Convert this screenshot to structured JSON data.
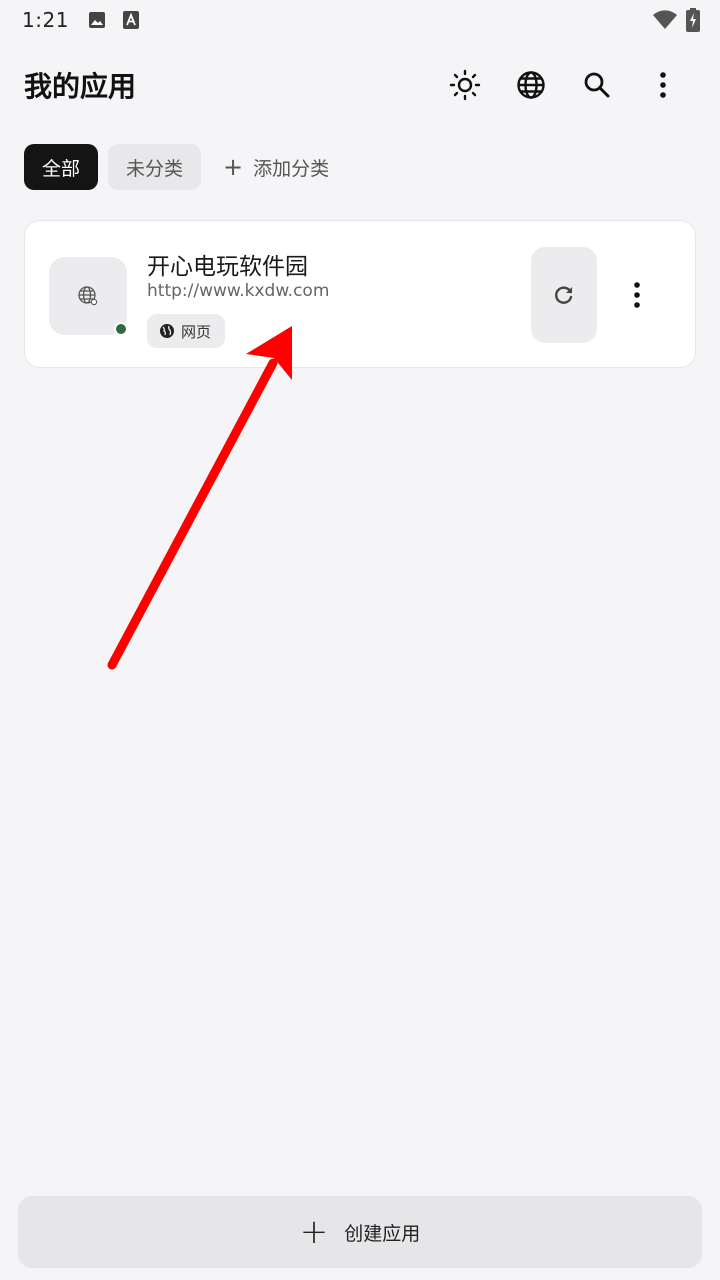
{
  "status_bar": {
    "time": "1:21",
    "icons": [
      "image-icon",
      "font-download-icon",
      "wifi-icon",
      "battery-charging-icon"
    ]
  },
  "header": {
    "title": "我的应用",
    "actions": [
      "theme-sun-icon",
      "globe-icon",
      "search-icon",
      "more-vertical-icon"
    ]
  },
  "categories": {
    "items": [
      {
        "label": "全部",
        "active": true
      },
      {
        "label": "未分类",
        "active": false
      }
    ],
    "add_label": "添加分类"
  },
  "apps": [
    {
      "name": "开心电玩软件园",
      "url": "http://www.kxdw.com",
      "type_label": "网页",
      "status_color": "#2e6b3f"
    }
  ],
  "create_button": {
    "label": "创建应用"
  },
  "colors": {
    "background": "#f5f5f8",
    "active_chip": "#141414",
    "annotation_arrow": "#ff0000"
  }
}
